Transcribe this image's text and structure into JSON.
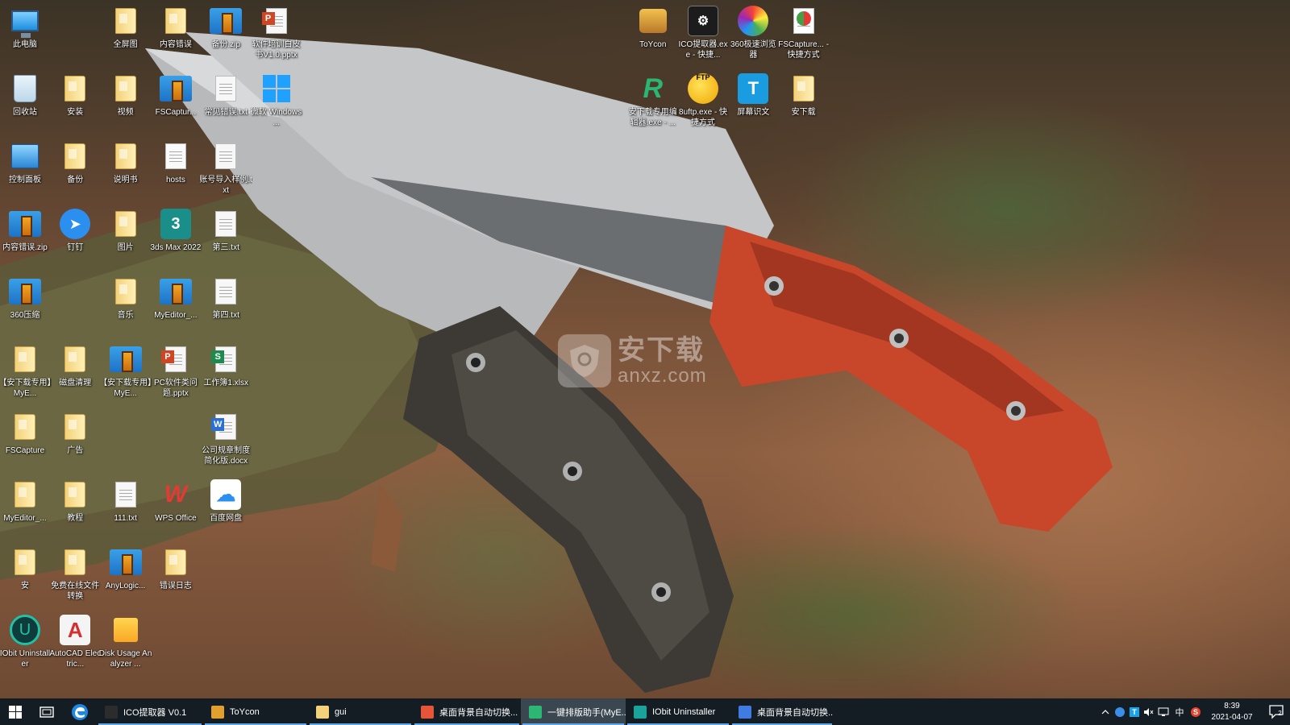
{
  "desktop_icons": [
    {
      "id": "this-pc",
      "label": "此电脑",
      "icon": "computer-icon"
    },
    {
      "id": "fullscreen",
      "label": "全屏图",
      "icon": "folder-icon"
    },
    {
      "id": "content-error",
      "label": "内容错误",
      "icon": "folder-icon"
    },
    {
      "id": "backup-zip",
      "label": "备份.zip",
      "icon": "zip-icon"
    },
    {
      "id": "training-pptx",
      "label": "软件培训白皮书V1.0.pptx",
      "icon": "pptx-icon"
    },
    {
      "id": "toycon",
      "label": "ToYcon",
      "icon": "toycon-icon"
    },
    {
      "id": "ico-extractor",
      "label": "ICO提取器.exe - 快捷...",
      "icon": "ico-extractor-icon"
    },
    {
      "id": "360-browser",
      "label": "360极速浏览器",
      "icon": "360-browser-icon"
    },
    {
      "id": "fscapture-shortcut",
      "label": "FSCapture... - 快捷方式",
      "icon": "fscapture-icon"
    },
    {
      "id": "recycle-bin",
      "label": "回收站",
      "icon": "recycle-bin-icon"
    },
    {
      "id": "install",
      "label": "安装",
      "icon": "folder-icon"
    },
    {
      "id": "video",
      "label": "视频",
      "icon": "folder-icon"
    },
    {
      "id": "fscapture-zip",
      "label": "FSCaptur...",
      "icon": "zip-icon"
    },
    {
      "id": "common-errors",
      "label": "常见错误.txt",
      "icon": "text-file-icon"
    },
    {
      "id": "weiruan-windows",
      "label": "微软 Windows ...",
      "icon": "windows-icon"
    },
    {
      "id": "editor-shortcut",
      "label": "安下载专用编辑器.exe - ...",
      "icon": "editor-icon"
    },
    {
      "id": "8uftp",
      "label": "8uftp.exe - 快捷方式",
      "icon": "ftp-icon"
    },
    {
      "id": "screen-ocr",
      "label": "屏幕识文",
      "icon": "screen-ocr-icon"
    },
    {
      "id": "anxz-folder",
      "label": "安下载",
      "icon": "folder-icon"
    },
    {
      "id": "control-panel",
      "label": "控制面板",
      "icon": "control-panel-icon"
    },
    {
      "id": "backup",
      "label": "备份",
      "icon": "folder-icon"
    },
    {
      "id": "manual",
      "label": "说明书",
      "icon": "folder-icon"
    },
    {
      "id": "hosts",
      "label": "hosts",
      "icon": "file-icon"
    },
    {
      "id": "account-import",
      "label": "账号导入样例.txt",
      "icon": "text-file-icon"
    },
    {
      "id": "content-error-zip",
      "label": "内容错误.zip",
      "icon": "zip-icon"
    },
    {
      "id": "dingding",
      "label": "钉钉",
      "icon": "dingtalk-icon"
    },
    {
      "id": "pictures",
      "label": "图片",
      "icon": "folder-icon"
    },
    {
      "id": "3dsmax",
      "label": "3ds Max 2022",
      "icon": "3dsmax-icon"
    },
    {
      "id": "third-txt",
      "label": "第三.txt",
      "icon": "text-file-icon"
    },
    {
      "id": "360zip",
      "label": "360压缩",
      "icon": "zip-icon"
    },
    {
      "id": "music",
      "label": "音乐",
      "icon": "folder-icon"
    },
    {
      "id": "myeditor-zip",
      "label": "MyEditor_...",
      "icon": "zip-icon"
    },
    {
      "id": "fourth-txt",
      "label": "第四.txt",
      "icon": "text-file-icon"
    },
    {
      "id": "anxz-myeditor-1",
      "label": "【安下载专用】MyE...",
      "icon": "folder-icon"
    },
    {
      "id": "disk-clean",
      "label": "磁盘清理",
      "icon": "folder-icon"
    },
    {
      "id": "anxz-myeditor-2",
      "label": "【安下载专用】MyE...",
      "icon": "zip-icon"
    },
    {
      "id": "pc-software-pptx",
      "label": "PC软件类问题.pptx",
      "icon": "pptx-icon"
    },
    {
      "id": "workbook",
      "label": "工作簿1.xlsx",
      "icon": "xlsx-icon"
    },
    {
      "id": "fscapture",
      "label": "FSCapture",
      "icon": "folder-icon"
    },
    {
      "id": "ads",
      "label": "广告",
      "icon": "folder-icon"
    },
    {
      "id": "company-docx",
      "label": "公司规章制度简化版.docx",
      "icon": "docx-icon"
    },
    {
      "id": "myeditor-folder",
      "label": "MyEditor_...",
      "icon": "folder-icon"
    },
    {
      "id": "tutorial",
      "label": "教程",
      "icon": "folder-icon"
    },
    {
      "id": "111-txt",
      "label": "111.txt",
      "icon": "text-file-icon"
    },
    {
      "id": "wps-office",
      "label": "WPS Office",
      "icon": "wps-icon"
    },
    {
      "id": "baidu-netdisk",
      "label": "百度网盘",
      "icon": "baidu-netdisk-icon"
    },
    {
      "id": "an",
      "label": "安",
      "icon": "folder-icon"
    },
    {
      "id": "online-convert",
      "label": "免费在线文件转换",
      "icon": "folder-icon"
    },
    {
      "id": "anylogic",
      "label": "AnyLogic...",
      "icon": "zip-icon"
    },
    {
      "id": "error-log",
      "label": "错误日志",
      "icon": "folder-icon"
    },
    {
      "id": "iobit",
      "label": "IObit Uninstaller",
      "icon": "iobit-icon"
    },
    {
      "id": "autocad",
      "label": "AutoCAD Electric...",
      "icon": "autocad-icon"
    },
    {
      "id": "disk-usage",
      "label": "Disk Usage Analyzer ...",
      "icon": "disk-usage-icon"
    }
  ],
  "watermark": {
    "big": "安下载",
    "small": "anxz.com"
  },
  "taskbar": {
    "apps": [
      {
        "label": "ICO提取器 V0.1",
        "icon": "ico-extractor-icon",
        "color": "#2c2c2c"
      },
      {
        "label": "ToYcon",
        "icon": "toycon-icon",
        "color": "#e0a030"
      },
      {
        "label": "gui",
        "icon": "folder-icon",
        "color": "#f3d27a"
      },
      {
        "label": "桌面背景自动切换...",
        "icon": "chrome-icon",
        "color": "#e6543a"
      },
      {
        "label": "一键排版助手(MyE...",
        "icon": "editor-icon",
        "color": "#2bb673"
      },
      {
        "label": "IObit Uninstaller",
        "icon": "iobit-icon",
        "color": "#1aa39a"
      },
      {
        "label": "桌面背景自动切换...",
        "icon": "app-icon",
        "color": "#3f7be0"
      }
    ],
    "tray": {
      "ime": "中",
      "time": "8:39",
      "date": "2021-04-07",
      "notification_count": "2"
    }
  }
}
